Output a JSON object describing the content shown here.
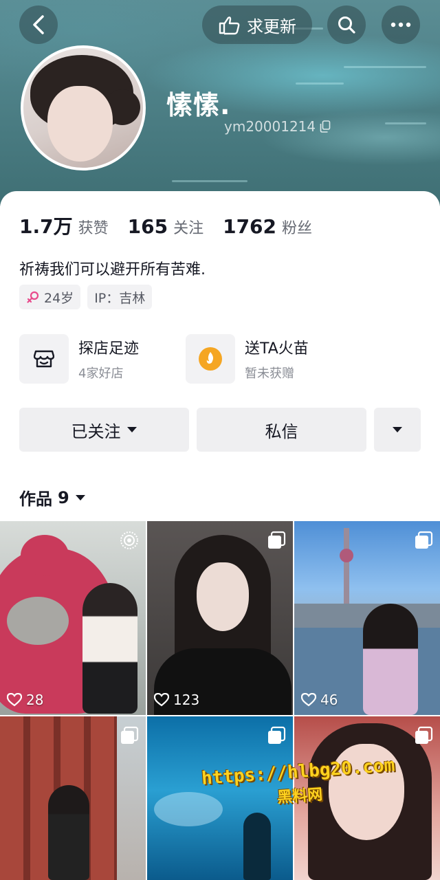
{
  "header": {
    "request_update_label": "求更新",
    "username": "愫愫.",
    "user_id": "ym20001214"
  },
  "stats": [
    {
      "value": "1.7万",
      "label": "获赞"
    },
    {
      "value": "165",
      "label": "关注"
    },
    {
      "value": "1762",
      "label": "粉丝"
    }
  ],
  "bio": "祈祷我们可以避开所有苦难.",
  "tags": {
    "age": "24岁",
    "ip": "IP：吉林"
  },
  "features": [
    {
      "title": "探店足迹",
      "subtitle": "4家好店",
      "icon": "store-icon"
    },
    {
      "title": "送TA火苗",
      "subtitle": "暂未获赠",
      "icon": "flame-icon"
    }
  ],
  "actions": {
    "follow_label": "已关注",
    "message_label": "私信"
  },
  "works": {
    "tab_label": "作品",
    "count": "9"
  },
  "posts": [
    {
      "likes": "28",
      "badge": "live-photo-icon"
    },
    {
      "likes": "123",
      "badge": "gallery-icon"
    },
    {
      "likes": "46",
      "badge": "gallery-icon"
    },
    {
      "likes": "",
      "badge": "gallery-icon"
    },
    {
      "likes": "",
      "badge": "gallery-icon"
    },
    {
      "likes": "",
      "badge": "gallery-icon"
    }
  ],
  "watermark": {
    "line1": "https://hlbg20.com",
    "line2": "黑料网"
  },
  "colors": {
    "header_water": "#4f8289",
    "text_primary": "#161823",
    "text_secondary": "#666a73",
    "button_bg": "#efeff1",
    "female_icon": "#e84a8b",
    "flame_icon": "#f5a623",
    "watermark": "#ffd21f"
  }
}
